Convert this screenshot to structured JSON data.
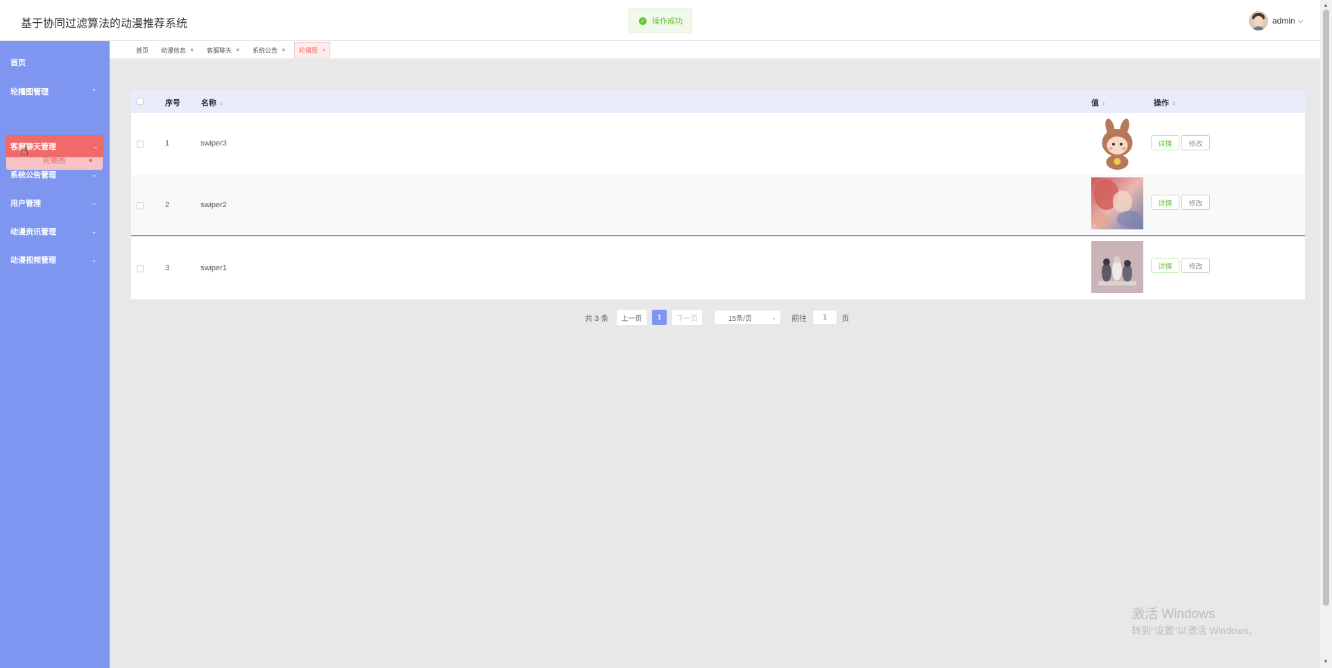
{
  "header": {
    "title": "基于协同过滤算法的动漫推荐系统",
    "toast": "操作成功",
    "user_name": "admin",
    "user_caret": "⌵"
  },
  "sidebar": {
    "items": [
      {
        "label": "首页"
      },
      {
        "label": "轮播图管理",
        "chevron": "⌃"
      },
      {
        "label": "客服聊天管理",
        "chevron": "⌄"
      },
      {
        "label": "系统公告管理",
        "chevron": "⌄"
      },
      {
        "label": "用户管理",
        "chevron": "⌄"
      },
      {
        "label": "动漫资讯管理",
        "chevron": "⌄"
      },
      {
        "label": "动漫视频管理",
        "chevron": "⌄"
      }
    ],
    "submenu": {
      "label": "轮播图"
    }
  },
  "tabs": [
    {
      "label": "首页"
    },
    {
      "label": "动漫信息",
      "close": "×"
    },
    {
      "label": "客服聊天",
      "close": "×"
    },
    {
      "label": "系统公告",
      "close": "×"
    },
    {
      "label": "轮播图",
      "close": "×"
    }
  ],
  "table": {
    "headers": {
      "index": "序号",
      "name": "名称",
      "value": "值",
      "action": "操作",
      "sort_icon": "⇕"
    },
    "rows": [
      {
        "index": "1",
        "name": "swiper3",
        "detail": "详情",
        "edit": "修改"
      },
      {
        "index": "2",
        "name": "swiper2",
        "detail": "详情",
        "edit": "修改"
      },
      {
        "index": "3",
        "name": "swiper1",
        "detail": "详情",
        "edit": "修改"
      }
    ]
  },
  "pagination": {
    "total": "共 3 条",
    "prev": "上一页",
    "current": "1",
    "next": "下一页",
    "page_size": "15条/页",
    "goto_label": "前往",
    "goto_value": "1",
    "page_suffix": "页"
  },
  "watermark": {
    "line1": "激活 Windows",
    "line2": "转到\"设置\"以激活 Windows。"
  },
  "colors": {
    "sidebar": "#7e96ef",
    "active": "#f06a6a",
    "success": "#67c23a"
  }
}
